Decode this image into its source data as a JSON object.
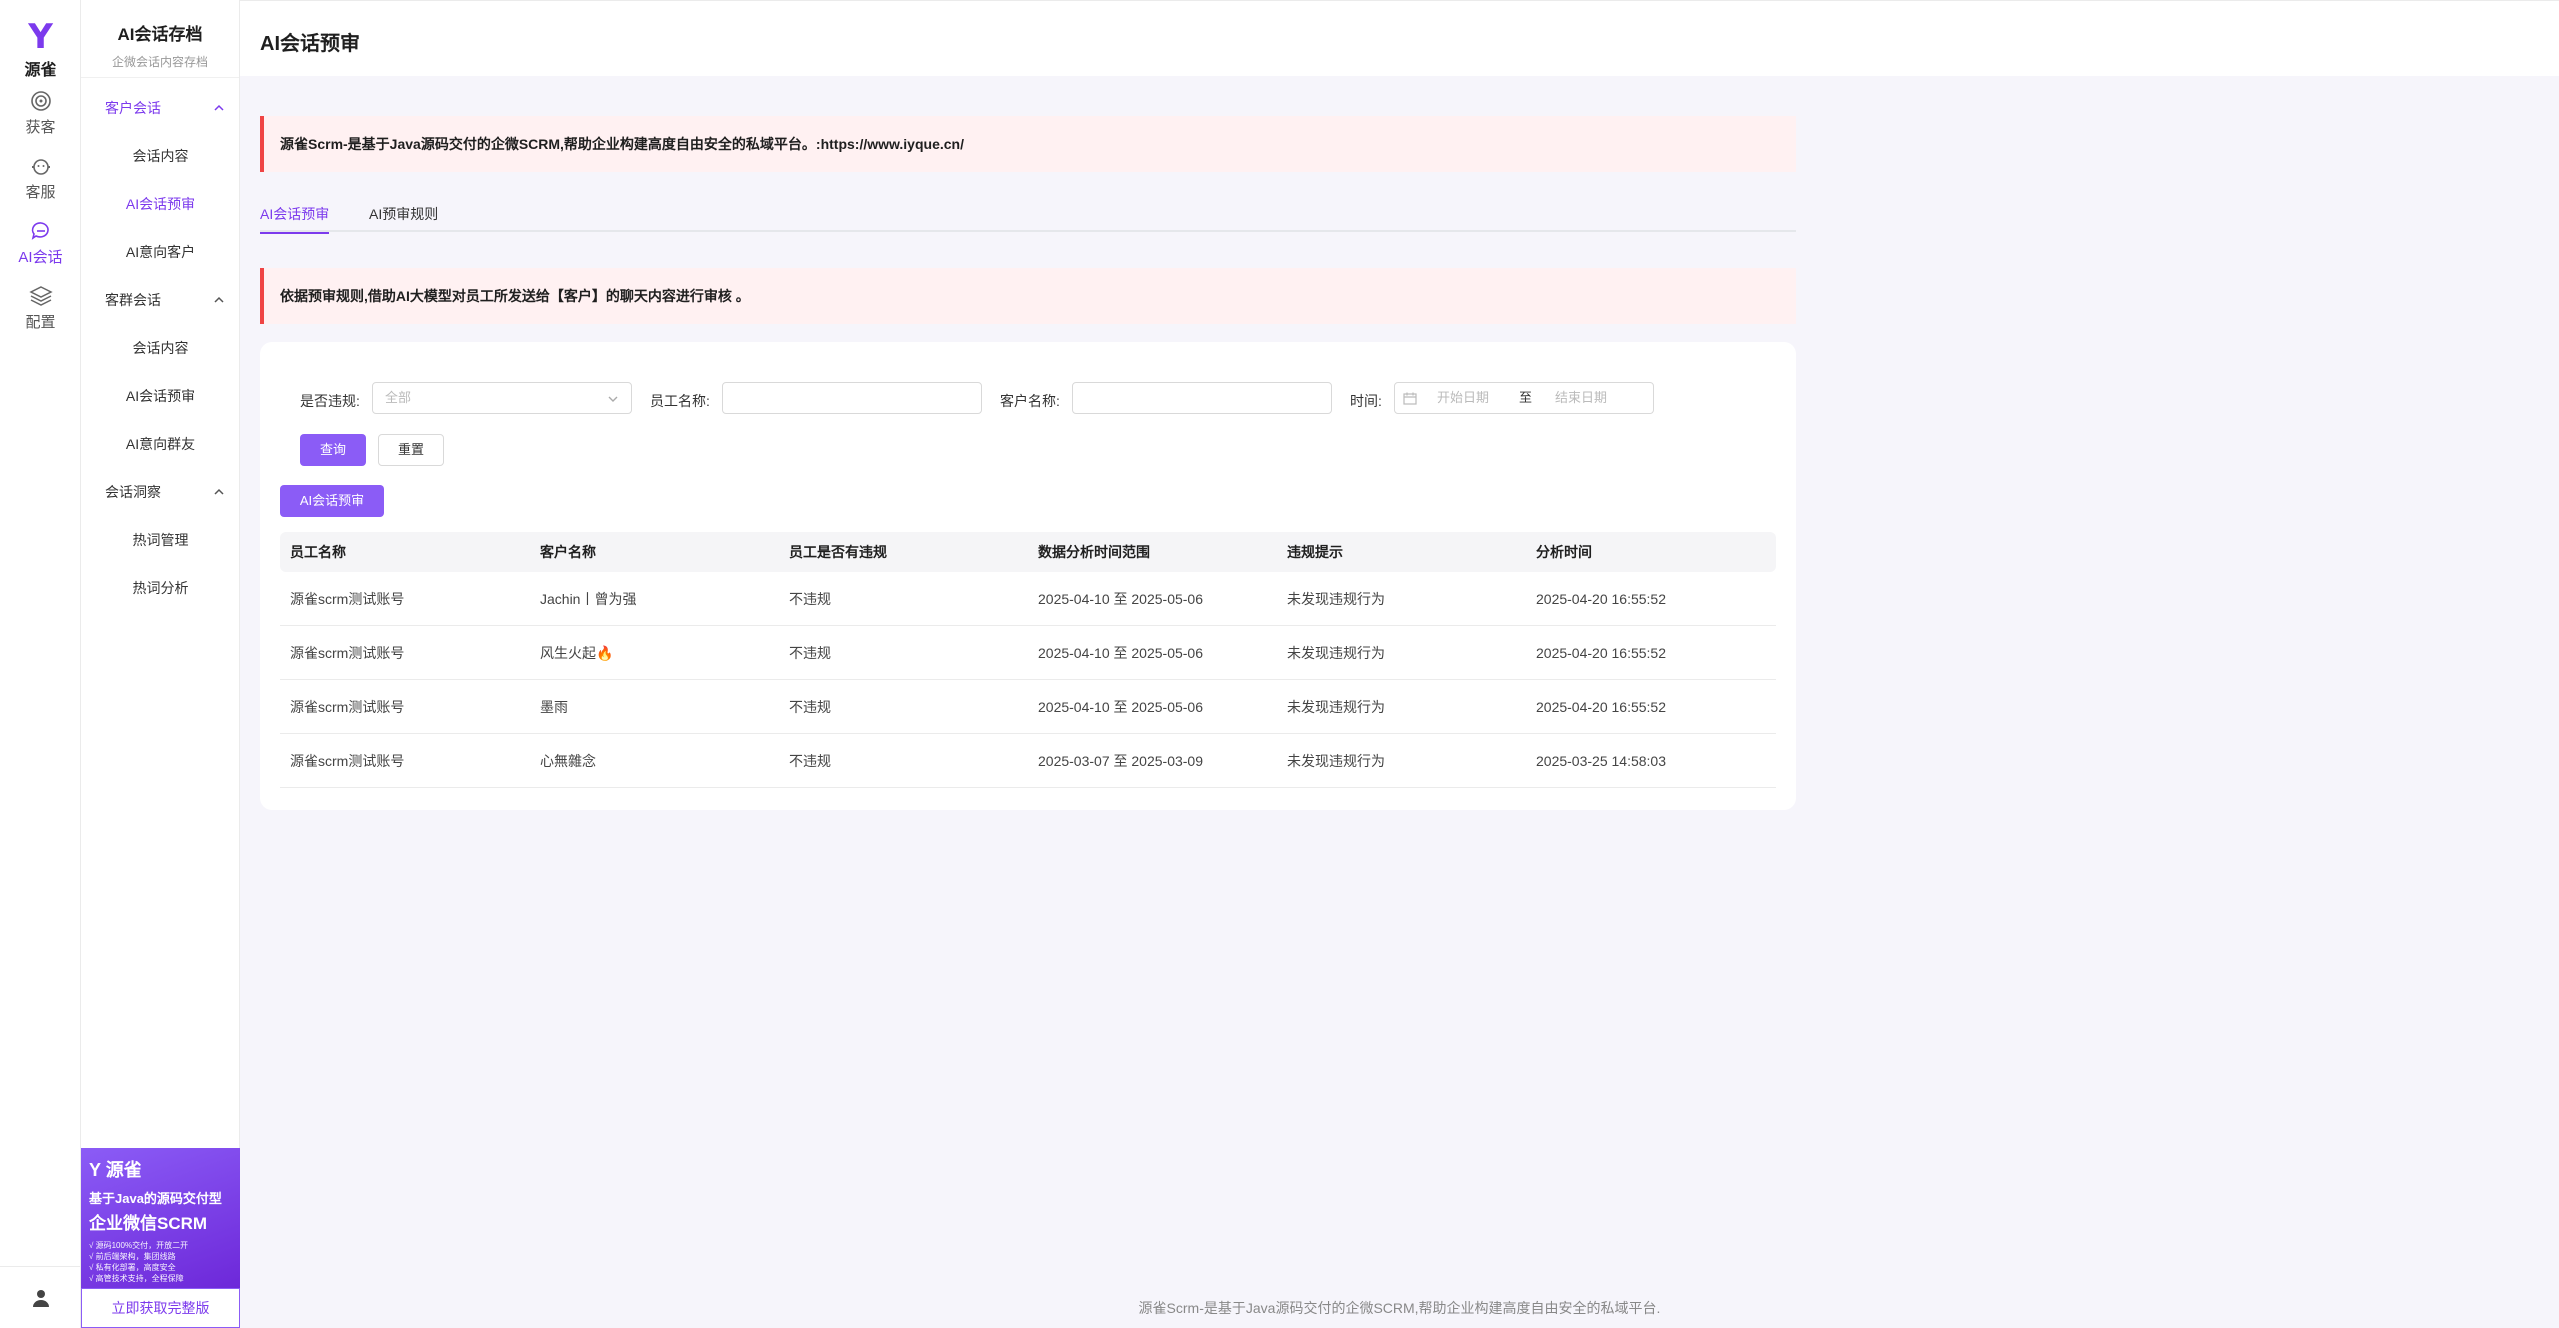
{
  "rail": {
    "logo_mark": "Y",
    "logo_name": "源雀",
    "items": [
      {
        "label": "获客"
      },
      {
        "label": "客服"
      },
      {
        "label": "AI会话"
      },
      {
        "label": "配置"
      }
    ]
  },
  "subnav": {
    "title": "AI会话存档",
    "subtitle": "企微会话内容存档",
    "groups": [
      {
        "title": "客户会话",
        "items": [
          "会话内容",
          "AI会话预审",
          "AI意向客户"
        ]
      },
      {
        "title": "客群会话",
        "items": [
          "会话内容",
          "AI会话预审",
          "AI意向群友"
        ]
      },
      {
        "title": "会话洞察",
        "items": [
          "热词管理",
          "热词分析"
        ]
      }
    ],
    "promo": {
      "brand": "源雀",
      "line1": "基于Java的源码交付型",
      "line2": "企业微信SCRM",
      "bullets": [
        "√ 源码100%交付，开放二开",
        "√ 前后端架构，集团线路",
        "√ 私有化部署，高度安全",
        "√ 高管技术支持，全程保障"
      ],
      "cta": "立即获取完整版"
    }
  },
  "page": {
    "title": "AI会话预审",
    "banner_top": "源雀Scrm-是基于Java源码交付的企微SCRM,帮助企业构建高度自由安全的私域平台。:https://www.iyque.cn/",
    "tabs": [
      "AI会话预审",
      "AI预审规则"
    ],
    "banner_rule": "依据预审规则,借助AI大模型对员工所发送给【客户】的聊天内容进行审核 。"
  },
  "filters": {
    "violation_label": "是否违规:",
    "violation_value": "全部",
    "staff_label": "员工名称:",
    "staff_value": "",
    "customer_label": "客户名称:",
    "customer_value": "",
    "time_label": "时间:",
    "start_placeholder": "开始日期",
    "range_sep": "至",
    "end_placeholder": "结束日期",
    "query_button": "查询",
    "reset_button": "重置",
    "ai_review_button": "AI会话预审"
  },
  "table": {
    "columns": [
      "员工名称",
      "客户名称",
      "员工是否有违规",
      "数据分析时间范围",
      "违规提示",
      "分析时间"
    ],
    "rows": [
      [
        "源雀scrm测试账号",
        "Jachin丨曾为强",
        "不违规",
        "2025-04-10 至 2025-05-06",
        "未发现违规行为",
        "2025-04-20 16:55:52"
      ],
      [
        "源雀scrm测试账号",
        "风生火起🔥",
        "不违规",
        "2025-04-10 至 2025-05-06",
        "未发现违规行为",
        "2025-04-20 16:55:52"
      ],
      [
        "源雀scrm测试账号",
        "墨雨",
        "不违规",
        "2025-04-10 至 2025-05-06",
        "未发现违规行为",
        "2025-04-20 16:55:52"
      ],
      [
        "源雀scrm测试账号",
        "心無雜念",
        "不违规",
        "2025-03-07 至 2025-03-09",
        "未发现违规行为",
        "2025-03-25 14:58:03"
      ]
    ]
  },
  "footer": "源雀Scrm-是基于Java源码交付的企微SCRM,帮助企业构建高度自由安全的私域平台.",
  "colors": {
    "accent": "#8b5cf6",
    "accent_text": "#7c3aed",
    "alert_border": "#ef4444",
    "alert_bg": "#fff1f2"
  }
}
